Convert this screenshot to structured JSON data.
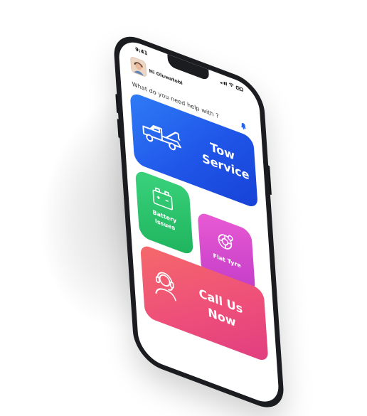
{
  "status_bar": {
    "time": "9:41"
  },
  "header": {
    "greeting": "Hi Oluwatobi"
  },
  "prompt": {
    "question": "What do you need help with ?"
  },
  "cards": {
    "tow": {
      "line1": "Tow",
      "line2": "Service",
      "color": "#2563eb"
    },
    "battery": {
      "line1": "Battery",
      "line2": "Issues",
      "color": "#22c55e"
    },
    "flat_tyre": {
      "label": "Flat Tyre",
      "color": "#d946ef"
    },
    "call": {
      "line1": "Call Us",
      "line2": "Now",
      "color": "#f43f5e"
    }
  },
  "icons": {
    "notification": "bell-icon",
    "tow": "tow-truck-icon",
    "battery": "car-battery-icon",
    "flat_tyre": "tyre-icon",
    "call": "headset-agent-icon"
  }
}
